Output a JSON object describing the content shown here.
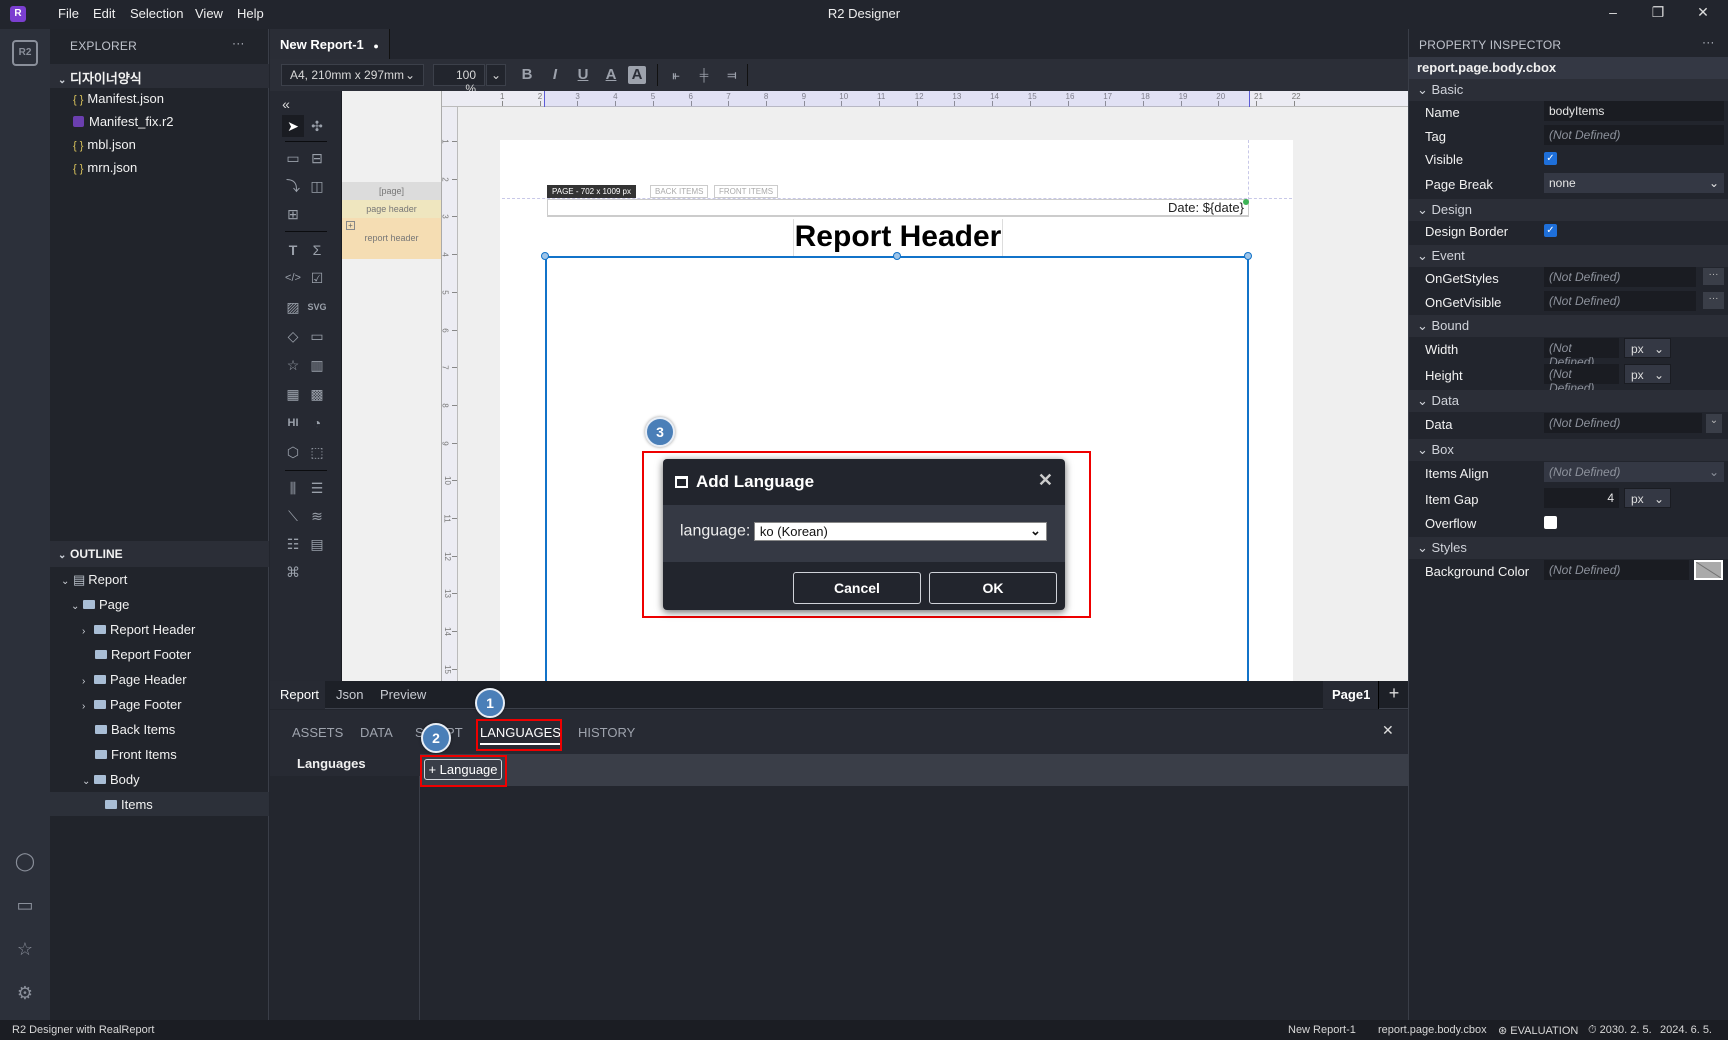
{
  "app": {
    "title": "R2 Designer",
    "logo": "R",
    "menu": [
      "File",
      "Edit",
      "Selection",
      "View",
      "Help"
    ],
    "window_controls": {
      "minimize": "–",
      "restore": "❐",
      "close": "✕"
    }
  },
  "activity_bar": {
    "top_icon": "r2-logo-icon",
    "bottom_icons": [
      "account-icon",
      "gift-icon",
      "feedback-icon",
      "settings-icon"
    ]
  },
  "explorer": {
    "header": "EXPLORER",
    "more": "···",
    "root_folder": "디자이너양식",
    "files": [
      {
        "name": "Manifest.json",
        "type": "json"
      },
      {
        "name": "Manifest_fix.r2",
        "type": "r2"
      },
      {
        "name": "mbl.json",
        "type": "json"
      },
      {
        "name": "mrn.json",
        "type": "json"
      }
    ]
  },
  "outline": {
    "header": "OUTLINE",
    "items": [
      {
        "label": "Report",
        "level": 0,
        "expanded": true
      },
      {
        "label": "Page",
        "level": 1,
        "expanded": true
      },
      {
        "label": "Report Header",
        "level": 2,
        "collapsed": true
      },
      {
        "label": "Report Footer",
        "level": 2
      },
      {
        "label": "Page Header",
        "level": 2,
        "collapsed": true
      },
      {
        "label": "Page Footer",
        "level": 2,
        "collapsed": true
      },
      {
        "label": "Back Items",
        "level": 2
      },
      {
        "label": "Front Items",
        "level": 2
      },
      {
        "label": "Body",
        "level": 2,
        "expanded": true
      },
      {
        "label": "Items",
        "level": 3,
        "selected": true
      }
    ]
  },
  "editor": {
    "tab": {
      "label": "New Report-1",
      "modified_dot": "●"
    },
    "toolbar": {
      "paper_size": "A4, 210mm x 297mm",
      "zoom": "100 %",
      "format_buttons": [
        "B",
        "I",
        "U",
        "A",
        "A"
      ],
      "align_buttons": [
        "align-left",
        "align-center",
        "align-right"
      ]
    },
    "collapse": "«",
    "bands": {
      "page": "[page]",
      "page_header": "page header",
      "report_header": "report header"
    },
    "ruler_h": [
      "1",
      "2",
      "3",
      "4",
      "5",
      "6",
      "7",
      "8",
      "9",
      "10",
      "11",
      "12",
      "13",
      "14",
      "15",
      "16",
      "17",
      "18",
      "19",
      "20",
      "21",
      "22"
    ],
    "ruler_v": [
      "1",
      "2",
      "3",
      "4",
      "5",
      "6",
      "7",
      "8",
      "9",
      "10",
      "11",
      "12",
      "13",
      "14",
      "15"
    ],
    "page_tabs": [
      "PAGE - 702 x 1009 px",
      "BACK ITEMS",
      "FRONT ITEMS"
    ],
    "date_label": "Date:",
    "date_value": "${date}",
    "report_header_title": "Report Header",
    "design_tabs": [
      "Report",
      "Json",
      "Preview"
    ],
    "page_tab": "Page1",
    "add_page": "+"
  },
  "dialog": {
    "title": "Add Language",
    "field_label": "language:",
    "selected": "ko (Korean)",
    "cancel": "Cancel",
    "ok": "OK",
    "close": "✕"
  },
  "bottom_panel": {
    "tabs": [
      "ASSETS",
      "DATA",
      "SCRIPT",
      "LANGUAGES",
      "HISTORY"
    ],
    "active_tab": "LANGUAGES",
    "side_title": "Languages",
    "add_button": "+ Language",
    "close": "✕"
  },
  "badges": [
    "1",
    "2",
    "3"
  ],
  "inspector": {
    "header": "PROPERTY INSPECTOR",
    "more": "···",
    "path": "report.page.body.cbox",
    "sections": {
      "basic": "Basic",
      "design": "Design",
      "event": "Event",
      "bound": "Bound",
      "data": "Data",
      "box": "Box",
      "styles": "Styles"
    },
    "props": {
      "name": {
        "label": "Name",
        "value": "bodyItems"
      },
      "tag": {
        "label": "Tag",
        "value": "(Not Defined)"
      },
      "visible": {
        "label": "Visible",
        "checked": true
      },
      "page_break": {
        "label": "Page Break",
        "value": "none"
      },
      "design_border": {
        "label": "Design Border",
        "checked": true
      },
      "on_get_styles": {
        "label": "OnGetStyles",
        "value": "(Not Defined)"
      },
      "on_get_visible": {
        "label": "OnGetVisible",
        "value": "(Not Defined)"
      },
      "width": {
        "label": "Width",
        "value": "(Not Defined)",
        "unit": "px"
      },
      "height": {
        "label": "Height",
        "value": "(Not Defined)",
        "unit": "px"
      },
      "data": {
        "label": "Data",
        "value": "(Not Defined)"
      },
      "items_align": {
        "label": "Items Align",
        "value": "(Not Defined)"
      },
      "item_gap": {
        "label": "Item Gap",
        "value": "4",
        "unit": "px"
      },
      "overflow": {
        "label": "Overflow",
        "checked": false
      },
      "background_color": {
        "label": "Background Color",
        "value": "(Not Defined)"
      }
    },
    "dots": "···"
  },
  "statusbar": {
    "left": "R2 Designer with RealReport",
    "file": "New Report-1",
    "path": "report.page.body.cbox",
    "license": "EVALUATION",
    "expiry": "2030. 2. 5.",
    "date": "2024. 6. 5."
  },
  "colors": {
    "accent": "#1173c9",
    "highlight_box": "#e00000",
    "badge": "#4a7fb8",
    "checkbox": "#1e6fd9"
  }
}
